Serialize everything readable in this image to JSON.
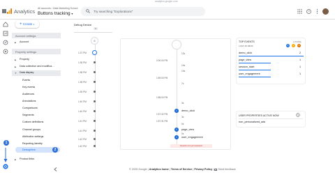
{
  "browser": {
    "url": "analytics.google.com"
  },
  "header": {
    "app_name": "Analytics",
    "account_line": "All accounts › Data Marketing School",
    "property_name": "Buttons tracking",
    "property_caret": "▾",
    "search_placeholder": "Try searching \"Explorations\""
  },
  "sidebar": {
    "create_label": "Create",
    "account_settings": "Account settings",
    "account_items": [
      "Account"
    ],
    "property_settings": "Property settings",
    "property_items": [
      "Property",
      "Data collection and modifica…",
      "Data display"
    ],
    "data_display_items": [
      "Events",
      "Key events",
      "Audiences",
      "Annotations",
      "Comparisons",
      "Segments",
      "Custom definitions",
      "Channel groups",
      "Attribution settings",
      "Reporting identity",
      "DebugView"
    ],
    "product_links": "Product links",
    "collapse_icon": "chevron-left-icon"
  },
  "debug": {
    "device_label": "Debug Device",
    "device_count": "0",
    "minutes_count": "6",
    "times": [
      "1:37 PM",
      "1:38 PM",
      "1:38 PM",
      "1:38 PM",
      "1:39 PM",
      "1:40 PM",
      "1:40 PM",
      "1:41 PM",
      "1:41 PM",
      "1:42 PM",
      "1:42 PM"
    ]
  },
  "timeline": {
    "seconds": [
      "12s",
      "10s",
      "10s",
      "7s",
      "3s",
      "3s",
      "0s",
      "0s"
    ],
    "times": [
      "2:00:00 PM",
      "1:59:00 PM",
      "1:58:00 PM",
      "1:57:32 PM",
      "1:57:31 PM"
    ],
    "events": [
      {
        "name": "demo_click",
        "time": "1:57:32 PM"
      },
      {
        "name": "page_view",
        "time": ""
      },
      {
        "name": "user_engagement",
        "time": ""
      }
    ],
    "banner": "Events not yet received"
  },
  "top_events": {
    "title": "TOP EVENTS",
    "subtitle": "LAST 30 MINS",
    "total_label": "4 TOTAL",
    "badges": [
      "5",
      "0",
      "0"
    ],
    "rows": [
      {
        "name": "demo_click",
        "value": "2"
      },
      {
        "name": "page_view",
        "value": "1"
      },
      {
        "name": "session_start",
        "value": "1"
      },
      {
        "name": "user_engagement",
        "value": "1"
      }
    ]
  },
  "user_props": {
    "title": "USER PROPERTIES ACTIVE NOW",
    "rows": [
      "non_personalized_ads"
    ]
  },
  "annotations": [
    "1",
    "2",
    "3"
  ],
  "footer": {
    "copyright": "© 2025 Google |",
    "home": "Analytics home",
    "sep1": "|",
    "terms": "Terms of Service",
    "sep2": "|",
    "privacy": "Privacy Policy",
    "sep3": "|",
    "feedback": "Send feedback"
  },
  "colors": {
    "accent": "#1a73e8",
    "annotation": "#2f6fd6",
    "event_icon": "#1967d2"
  }
}
